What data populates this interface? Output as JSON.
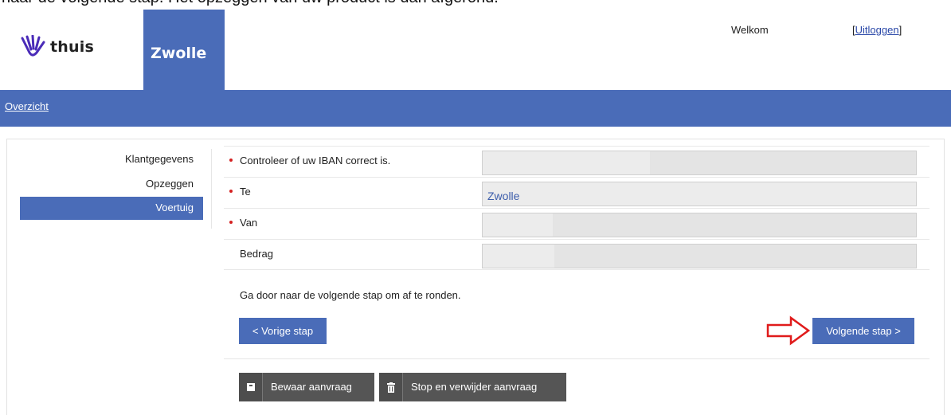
{
  "top_caption": "naar de volgende stap. Het opzeggen van uw product is dan afgerond.",
  "header": {
    "logo_text": "thuis",
    "city": "Zwolle",
    "welcome": "Welkom",
    "logout_open": "[",
    "logout_label": "Uitloggen",
    "logout_close": "]"
  },
  "nav": {
    "overview_label": "Overzicht"
  },
  "sidebar": {
    "items": [
      {
        "label": "Klantgegevens",
        "active": false
      },
      {
        "label": "Opzeggen",
        "active": false
      },
      {
        "label": "Voertuig",
        "active": true
      }
    ]
  },
  "form": {
    "rows": [
      {
        "label": "Controleer of uw IBAN correct is.",
        "required": true,
        "value": ""
      },
      {
        "label": "Te",
        "required": true,
        "value": "Zwolle"
      },
      {
        "label": "Van",
        "required": true,
        "value": ""
      },
      {
        "label": "Bedrag",
        "required": false,
        "value": ""
      }
    ],
    "note": "Ga door naar de volgende stap om af te ronden."
  },
  "buttons": {
    "prev": "< Vorige stap",
    "next": "Volgende stap >",
    "save": "Bewaar aanvraag",
    "stop": "Stop en verwijder aanvraag"
  },
  "colors": {
    "brand_blue": "#4a6cb8",
    "annotation_red": "#e01b1b",
    "dark_button": "#555555"
  }
}
